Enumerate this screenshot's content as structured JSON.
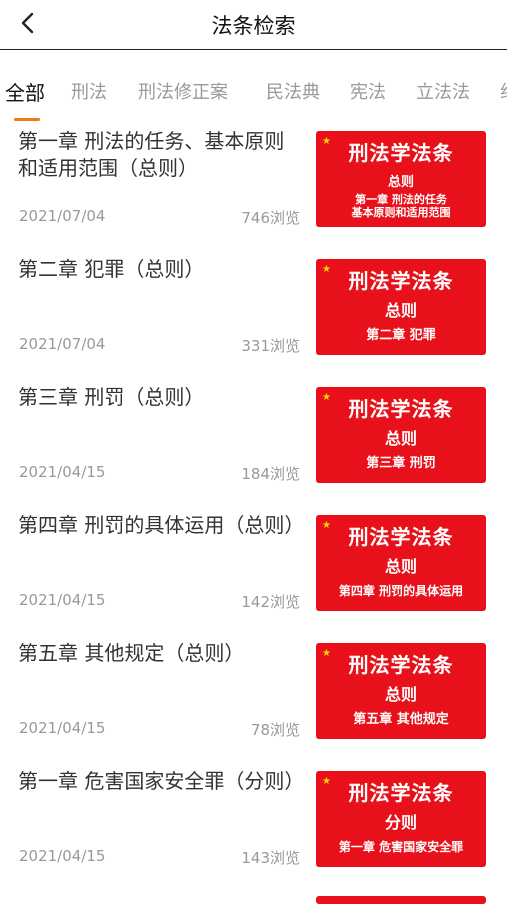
{
  "header": {
    "title": "法条检索",
    "back_icon": "chevron-left-icon"
  },
  "tabs": [
    {
      "label": "全部",
      "active": true
    },
    {
      "label": "刑法"
    },
    {
      "label": "刑法修正案"
    },
    {
      "label": "民法典"
    },
    {
      "label": "宪法"
    },
    {
      "label": "立法法"
    },
    {
      "label": "组"
    }
  ],
  "colors": {
    "accent": "#f07a14",
    "thumb_bg": "#e8101a"
  },
  "items": [
    {
      "title": "第一章 刑法的任务、基本原则和适用范围（总则）",
      "date": "2021/07/04",
      "views": "746浏览",
      "thumb": {
        "line1": "刑法学法条",
        "line2": "总则",
        "line3": "第一章 刑法的任务\n基本原则和适用范围"
      }
    },
    {
      "title": "第二章 犯罪（总则）",
      "date": "2021/07/04",
      "views": "331浏览",
      "thumb": {
        "line1": "刑法学法条",
        "line2": "总则",
        "line3": "第二章 犯罪"
      }
    },
    {
      "title": "第三章 刑罚（总则）",
      "date": "2021/04/15",
      "views": "184浏览",
      "thumb": {
        "line1": "刑法学法条",
        "line2": "总则",
        "line3": "第三章 刑罚"
      }
    },
    {
      "title": "第四章 刑罚的具体运用（总则）",
      "date": "2021/04/15",
      "views": "142浏览",
      "thumb": {
        "line1": "刑法学法条",
        "line2": "总则",
        "line3": "第四章 刑罚的具体运用"
      }
    },
    {
      "title": "第五章 其他规定（总则）",
      "date": "2021/04/15",
      "views": "78浏览",
      "thumb": {
        "line1": "刑法学法条",
        "line2": "总则",
        "line3": "第五章 其他规定"
      }
    },
    {
      "title": "第一章 危害国家安全罪（分则）",
      "date": "2021/04/15",
      "views": "143浏览",
      "thumb": {
        "line1": "刑法学法条",
        "line2": "分则",
        "line3": "第一章 危害国家安全罪"
      }
    }
  ]
}
